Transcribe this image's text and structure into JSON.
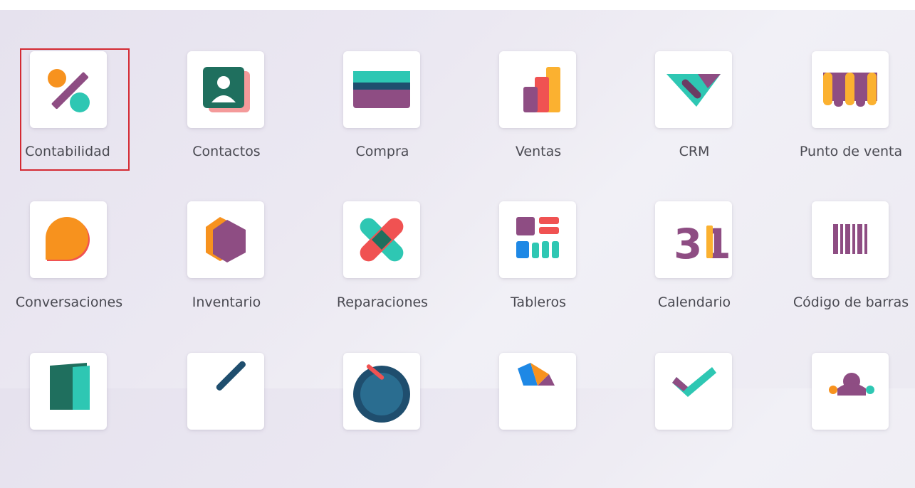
{
  "apps": {
    "row1": [
      {
        "label": "Contabilidad",
        "icon": "accounting-icon"
      },
      {
        "label": "Contactos",
        "icon": "contacts-icon"
      },
      {
        "label": "Compra",
        "icon": "purchase-icon"
      },
      {
        "label": "Ventas",
        "icon": "sales-icon"
      },
      {
        "label": "CRM",
        "icon": "crm-icon"
      },
      {
        "label": "Punto de venta",
        "icon": "point-of-sale-icon"
      }
    ],
    "row2": [
      {
        "label": "Conversaciones",
        "icon": "discuss-icon"
      },
      {
        "label": "Inventario",
        "icon": "inventory-icon"
      },
      {
        "label": "Reparaciones",
        "icon": "repairs-icon"
      },
      {
        "label": "Tableros",
        "icon": "dashboards-icon"
      },
      {
        "label": "Calendario",
        "icon": "calendar-icon",
        "glyph": "31"
      },
      {
        "label": "Código de barras",
        "icon": "barcode-icon"
      }
    ]
  },
  "colors": {
    "purple": "#8e4d83",
    "teal": "#2ec7b3",
    "orange": "#f7921e",
    "yellow": "#fbb130",
    "red": "#f05252",
    "salmon": "#f49a9a",
    "navy": "#1f4e6e",
    "selection": "#d42a33"
  }
}
